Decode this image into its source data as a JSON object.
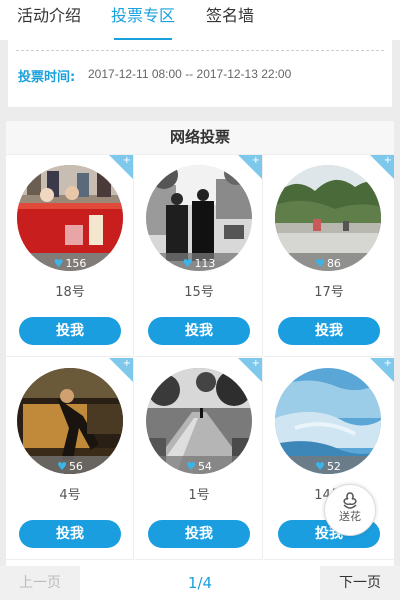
{
  "tabs": [
    {
      "label": "活动介绍",
      "active": false
    },
    {
      "label": "投票专区",
      "active": true
    },
    {
      "label": "签名墙",
      "active": false
    }
  ],
  "vote_time": {
    "label": "投票时间:",
    "value": "2017-12-11 08:00 -- 2017-12-13 22:00"
  },
  "panel": {
    "title": "网络投票",
    "entries": [
      {
        "votes": "156",
        "number": "18号",
        "button": "投我"
      },
      {
        "votes": "113",
        "number": "15号",
        "button": "投我"
      },
      {
        "votes": "86",
        "number": "17号",
        "button": "投我"
      },
      {
        "votes": "56",
        "number": "4号",
        "button": "投我"
      },
      {
        "votes": "54",
        "number": "1号",
        "button": "投我"
      },
      {
        "votes": "52",
        "number": "14号",
        "button": "投我"
      }
    ]
  },
  "float_button": {
    "label": "送花",
    "icon": "flower-icon"
  },
  "pager": {
    "prev": "上一页",
    "page": "1/4",
    "next": "下一页"
  },
  "colors": {
    "accent": "#1aa0dd",
    "button": "#1b9ee0",
    "corner": "#7ec8ec"
  }
}
